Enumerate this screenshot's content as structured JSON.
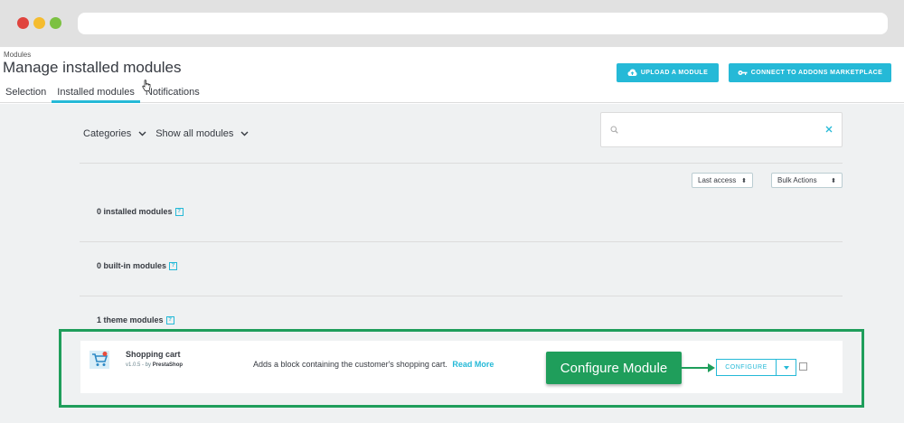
{
  "header": {
    "breadcrumb": "Modules",
    "title": "Manage installed modules",
    "tabs": [
      {
        "label": "Selection"
      },
      {
        "label": "Installed modules"
      },
      {
        "label": "Notifications"
      }
    ],
    "upload_label": "UPLOAD A MODULE",
    "connect_label": "CONNECT TO ADDONS MARKETPLACE"
  },
  "filters": {
    "categories_label": "Categories",
    "show_label": "Show all modules"
  },
  "search": {
    "placeholder": ""
  },
  "sort": {
    "selected": "Last access"
  },
  "bulk": {
    "selected": "Bulk Actions"
  },
  "sections": [
    {
      "title": "0 installed modules",
      "help": "?"
    },
    {
      "title": "0 built-in modules",
      "help": "?"
    },
    {
      "title": "1 theme modules",
      "help": "?"
    }
  ],
  "module": {
    "name": "Shopping cart",
    "version": "v1.0.5 - by",
    "author": "PrestaShop",
    "description": "Adds a block containing the customer's shopping cart.",
    "read_more": "Read More",
    "configure_label": "CONFIGURE"
  },
  "annotation": {
    "callout": "Configure Module"
  },
  "colors": {
    "accent": "#25b9d7",
    "annotation": "#1f9e5b",
    "background": "#eff1f2"
  }
}
